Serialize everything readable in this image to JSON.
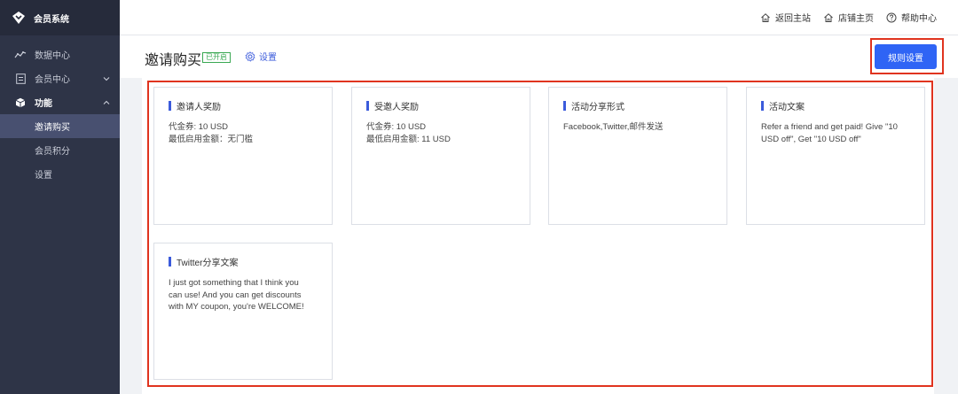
{
  "brand": {
    "name": "会员系统"
  },
  "sidebar": {
    "items": [
      {
        "label": "数据中心",
        "icon": "line-chart-icon"
      },
      {
        "label": "会员中心",
        "icon": "member-card-icon"
      },
      {
        "label": "功能",
        "icon": "cube-icon"
      }
    ],
    "sub_items": [
      {
        "label": "邀请购买",
        "active": true
      },
      {
        "label": "会员积分"
      },
      {
        "label": "设置"
      }
    ]
  },
  "topbar": {
    "links": [
      {
        "label": "返回主站",
        "icon": "home-icon"
      },
      {
        "label": "店铺主页",
        "icon": "home-icon"
      },
      {
        "label": "帮助中心",
        "icon": "help-icon"
      }
    ]
  },
  "page": {
    "title": "邀请购买",
    "status": "已开启",
    "settings_label": "设置",
    "rules_button": "规则设置"
  },
  "cards": [
    {
      "title": "邀请人奖励",
      "lines": [
        "代金券: 10 USD",
        "最低启用金额：无门槛"
      ]
    },
    {
      "title": "受邀人奖励",
      "lines": [
        "代金券: 10 USD",
        "最低启用金额: 11 USD"
      ]
    },
    {
      "title": "活动分享形式",
      "lines": [
        "Facebook,Twitter,邮件发送"
      ]
    },
    {
      "title": "活动文案",
      "lines": [
        "Refer a friend and get paid! Give \"10",
        "USD off\", Get \"10 USD off\""
      ]
    },
    {
      "title": "Twitter分享文案",
      "lines": [
        "I just got something that I think you",
        "can use! And you can get discounts",
        "with MY coupon, you're WELCOME!"
      ]
    }
  ],
  "colors": {
    "sidebar_bg": "#2e3447",
    "primary": "#2f64f5",
    "accent_bar": "#3b5bdb",
    "status_green": "#3aa853",
    "highlight_red": "#e0341f"
  }
}
